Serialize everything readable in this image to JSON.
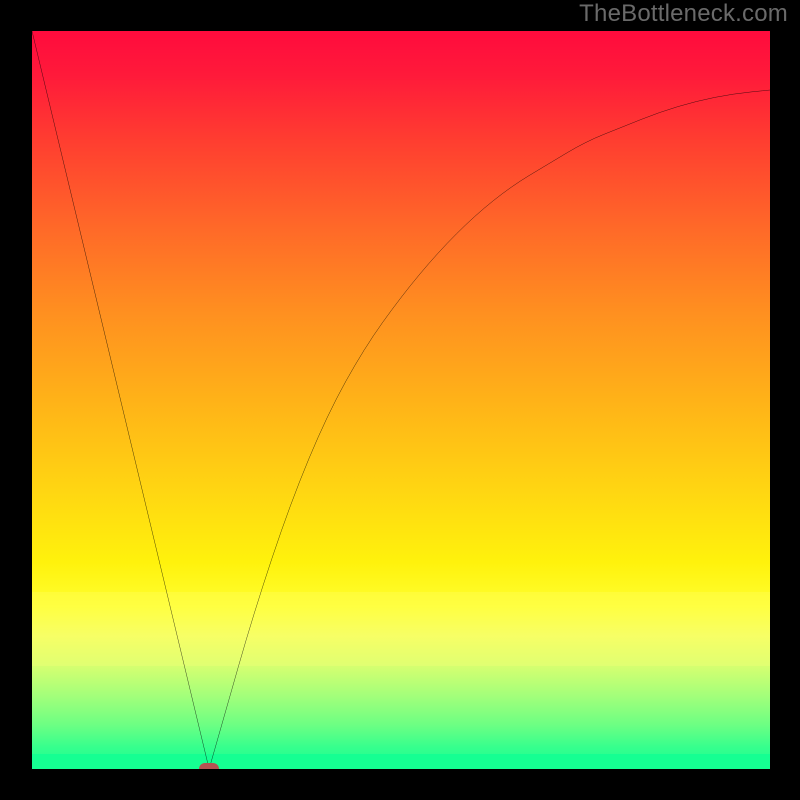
{
  "watermark": "TheBottleneck.com",
  "chart_data": {
    "type": "line",
    "title": "",
    "xlabel": "",
    "ylabel": "",
    "xlim": [
      0,
      100
    ],
    "ylim": [
      0,
      100
    ],
    "grid": false,
    "legend": false,
    "series": [
      {
        "name": "left-edge",
        "x": [
          0,
          24
        ],
        "values": [
          100,
          0
        ]
      },
      {
        "name": "right-curve",
        "x": [
          24,
          26,
          30,
          35,
          40,
          45,
          50,
          55,
          60,
          65,
          70,
          75,
          80,
          85,
          90,
          95,
          100
        ],
        "values": [
          0,
          7,
          21,
          36,
          48,
          57,
          64,
          70,
          75,
          79,
          82,
          85,
          87,
          89,
          90.5,
          91.5,
          92
        ]
      }
    ],
    "annotations": [
      {
        "name": "minimum-marker",
        "x": 24,
        "y": 0
      }
    ],
    "background": {
      "type": "vertical-gradient",
      "stops": [
        {
          "pos": 0.0,
          "color": "#ff0b3d"
        },
        {
          "pos": 0.5,
          "color": "#ffb218"
        },
        {
          "pos": 0.78,
          "color": "#ffff30"
        },
        {
          "pos": 1.0,
          "color": "#15ff92"
        }
      ]
    }
  },
  "colors": {
    "curve": "#000000",
    "marker": "#b55252",
    "frame": "#000000"
  }
}
